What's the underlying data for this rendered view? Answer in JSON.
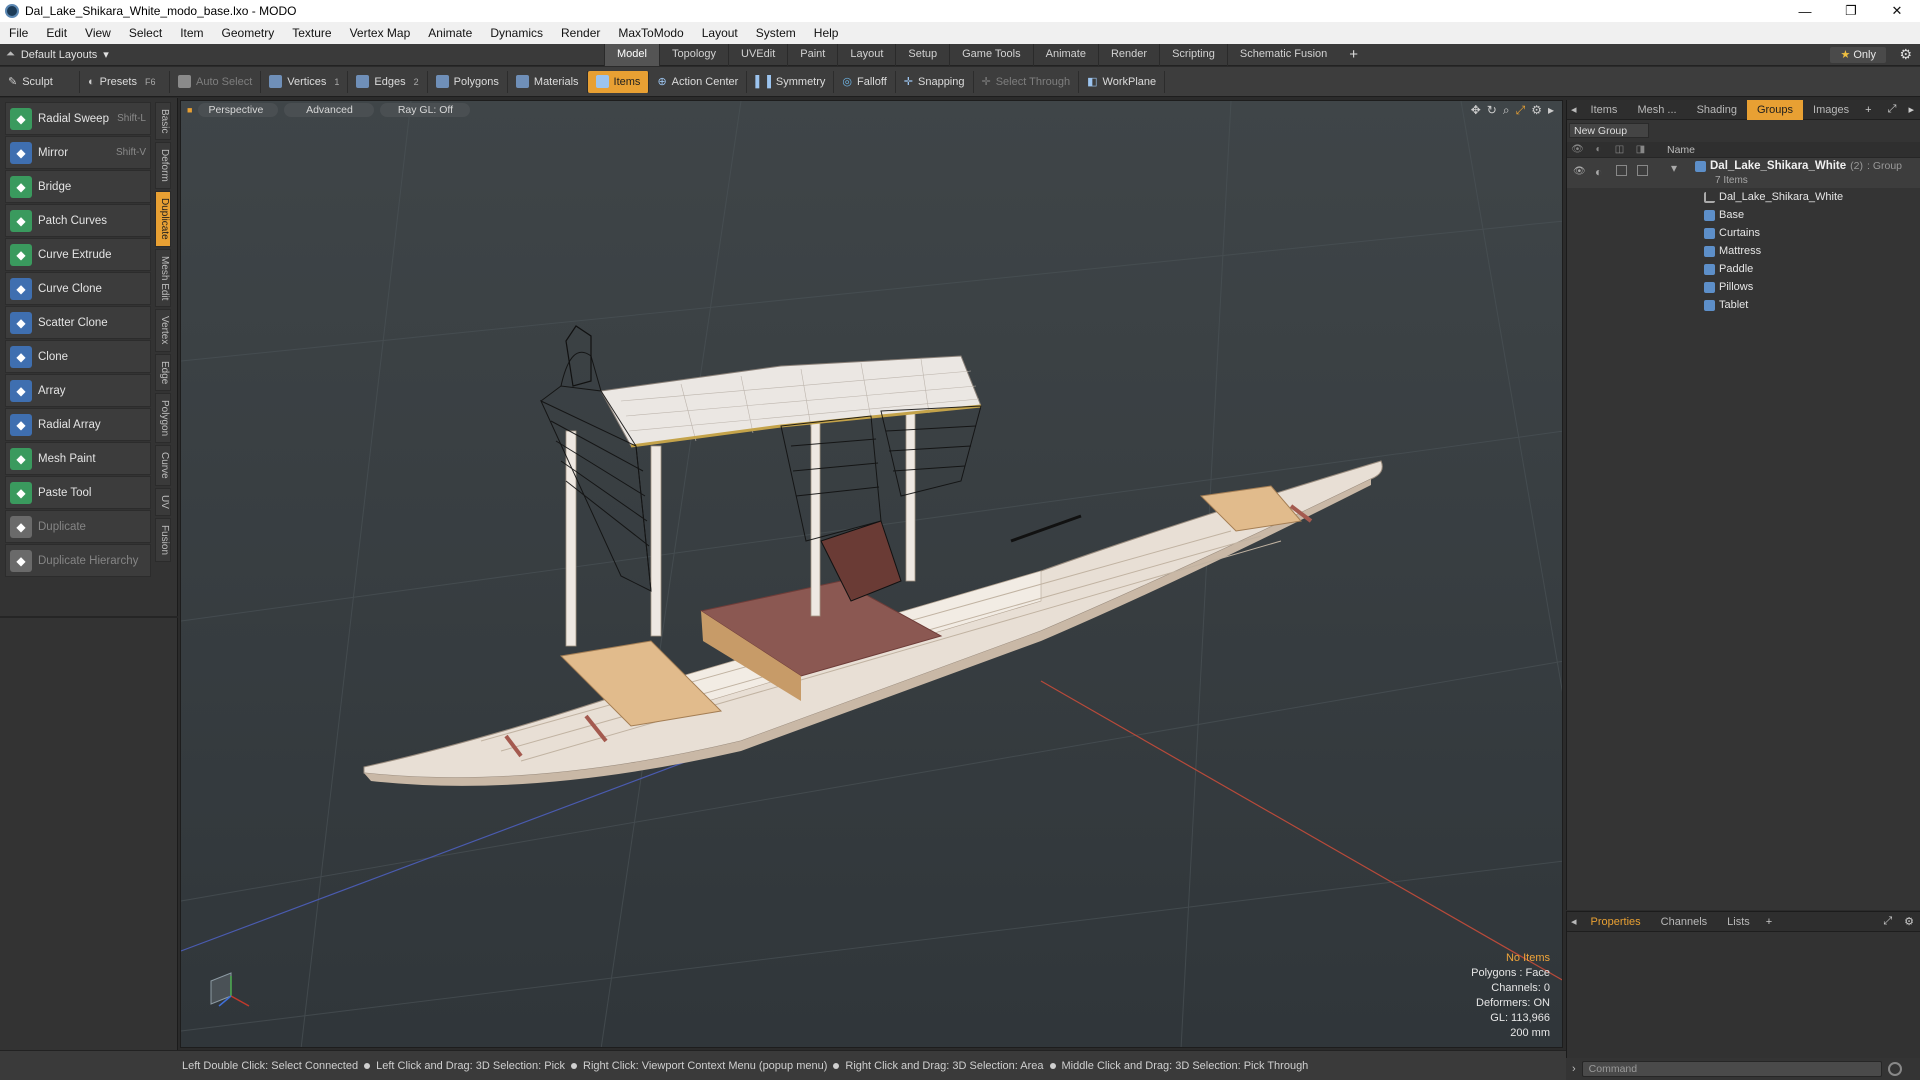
{
  "window": {
    "title": "Dal_Lake_Shikara_White_modo_base.lxo - MODO",
    "minimize": "—",
    "restore": "❐",
    "close": "✕"
  },
  "menu": [
    "File",
    "Edit",
    "View",
    "Select",
    "Item",
    "Geometry",
    "Texture",
    "Vertex Map",
    "Animate",
    "Dynamics",
    "Render",
    "MaxToModo",
    "Layout",
    "System",
    "Help"
  ],
  "layoutbar": {
    "layout_label": "Default Layouts",
    "tabs": [
      "Model",
      "Topology",
      "UVEdit",
      "Paint",
      "Layout",
      "Setup",
      "Game Tools",
      "Animate",
      "Render",
      "Scripting",
      "Schematic Fusion"
    ],
    "active_tab": "Model",
    "add": "+",
    "only_star": "★",
    "only_label": "Only"
  },
  "toolbar": {
    "sculpt": "Sculpt",
    "presets": "Presets",
    "presets_key": "F6",
    "auto_select": "Auto Select",
    "vertices": "Vertices",
    "vertices_count": "1",
    "edges": "Edges",
    "edges_count": "2",
    "polygons": "Polygons",
    "materials": "Materials",
    "items": "Items",
    "action_center": "Action Center",
    "symmetry": "Symmetry",
    "falloff": "Falloff",
    "snapping": "Snapping",
    "select_through": "Select Through",
    "workplane": "WorkPlane"
  },
  "tools": [
    {
      "label": "Radial Sweep",
      "shortcut": "Shift-L",
      "color": "#3a9a5e"
    },
    {
      "label": "Mirror",
      "shortcut": "Shift-V",
      "color": "#3f6fb0"
    },
    {
      "label": "Bridge",
      "shortcut": "",
      "color": "#3a9a5e"
    },
    {
      "label": "Patch Curves",
      "shortcut": "",
      "color": "#3a9a5e"
    },
    {
      "label": "Curve Extrude",
      "shortcut": "",
      "color": "#3a9a5e"
    },
    {
      "label": "Curve Clone",
      "shortcut": "",
      "color": "#3f6fb0"
    },
    {
      "label": "Scatter Clone",
      "shortcut": "",
      "color": "#3f6fb0"
    },
    {
      "label": "Clone",
      "shortcut": "",
      "color": "#3f6fb0"
    },
    {
      "label": "Array",
      "shortcut": "",
      "color": "#3f6fb0"
    },
    {
      "label": "Radial Array",
      "shortcut": "",
      "color": "#3f6fb0"
    },
    {
      "label": "Mesh Paint",
      "shortcut": "",
      "color": "#3a9a5e"
    },
    {
      "label": "Paste Tool",
      "shortcut": "",
      "color": "#3a9a5e"
    },
    {
      "label": "Duplicate",
      "shortcut": "",
      "color": "#6a6a6a",
      "disabled": true
    },
    {
      "label": "Duplicate Hierarchy",
      "shortcut": "",
      "color": "#6a6a6a",
      "disabled": true
    }
  ],
  "vtabs": [
    "Basic",
    "Deform",
    "Duplicate",
    "Mesh Edit",
    "Vertex",
    "Edge",
    "Polygon",
    "Curve",
    "UV",
    "Fusion"
  ],
  "active_vtab": "Duplicate",
  "viewport": {
    "perspective": "Perspective",
    "advanced": "Advanced",
    "raygl": "Ray GL: Off",
    "stats": {
      "no_items": "No Items",
      "polygons": "Polygons : Face",
      "channels": "Channels: 0",
      "deformers": "Deformers: ON",
      "gl": "GL: 113,966",
      "scale": "200 mm"
    }
  },
  "right_tabs": [
    "Items",
    "Mesh ...",
    "Shading",
    "Groups",
    "Images"
  ],
  "active_right_tab": "Groups",
  "groups": {
    "new_group": "New Group",
    "name_header": "Name",
    "group_name": "Dal_Lake_Shikara_White",
    "group_count": "(2)",
    "group_type": ": Group",
    "group_sub": "7 Items",
    "children": [
      "Dal_Lake_Shikara_White",
      "Base",
      "Curtains",
      "Mattress",
      "Paddle",
      "Pillows",
      "Tablet"
    ]
  },
  "props_tabs": [
    "Properties",
    "Channels",
    "Lists"
  ],
  "statusbar": [
    "Left Double Click: Select Connected",
    "Left Click and Drag: 3D Selection: Pick",
    "Right Click: Viewport Context Menu (popup menu)",
    "Right Click and Drag: 3D Selection: Area",
    "Middle Click and Drag: 3D Selection: Pick Through"
  ],
  "command": {
    "placeholder": "Command"
  },
  "colors": {
    "accent": "#e8a033",
    "viewport_bg": "#353b3e"
  }
}
